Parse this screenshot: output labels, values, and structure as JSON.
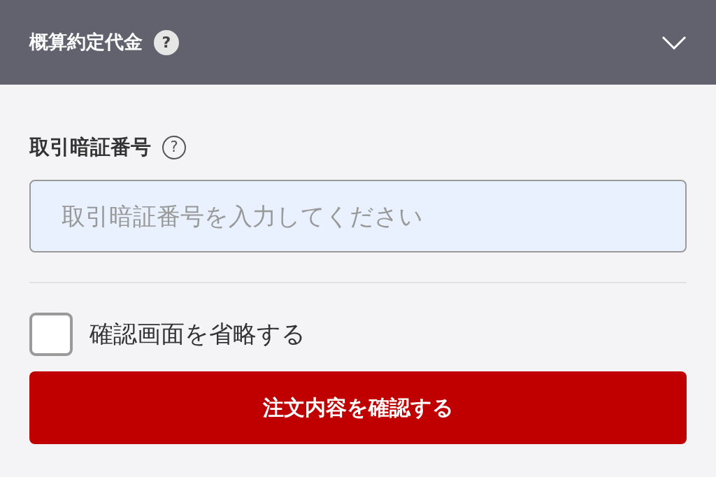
{
  "header": {
    "title": "概算約定代金",
    "help_icon": "?",
    "expanded": false
  },
  "pin": {
    "label": "取引暗証番号",
    "help_icon": "?",
    "placeholder": "取引暗証番号を入力してください"
  },
  "skip_confirm": {
    "label": "確認画面を省略する",
    "checked": false
  },
  "submit": {
    "label": "注文内容を確認する"
  }
}
